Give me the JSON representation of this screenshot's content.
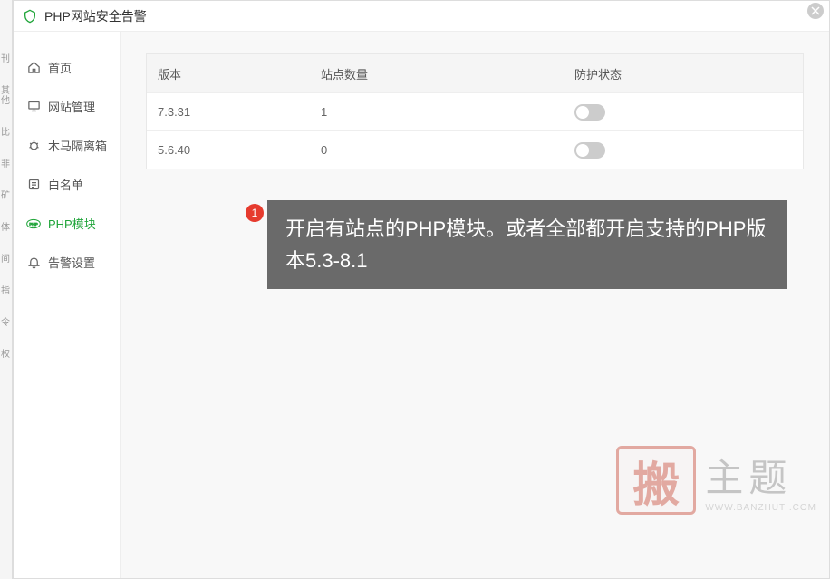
{
  "header": {
    "title": "PHP网站安全告警"
  },
  "sidebar": {
    "items": [
      {
        "label": "首页"
      },
      {
        "label": "网站管理"
      },
      {
        "label": "木马隔离箱"
      },
      {
        "label": "白名单"
      },
      {
        "label": "PHP模块"
      },
      {
        "label": "告警设置"
      }
    ]
  },
  "table": {
    "headers": {
      "version": "版本",
      "count": "站点数量",
      "status": "防护状态"
    },
    "rows": [
      {
        "version": "7.3.31",
        "count": "1"
      },
      {
        "version": "5.6.40",
        "count": "0"
      }
    ]
  },
  "tip": {
    "number": "1",
    "text": "开启有站点的PHP模块。或者全部都开启支持的PHP版本5.3-8.1"
  },
  "watermark": {
    "seal": "搬",
    "title": "主题",
    "url": "WWW.BANZHUTI.COM"
  },
  "leftLabels": [
    "刊",
    "其他",
    "比",
    "非",
    "矿",
    "体",
    "间",
    "指",
    "令",
    "权"
  ]
}
